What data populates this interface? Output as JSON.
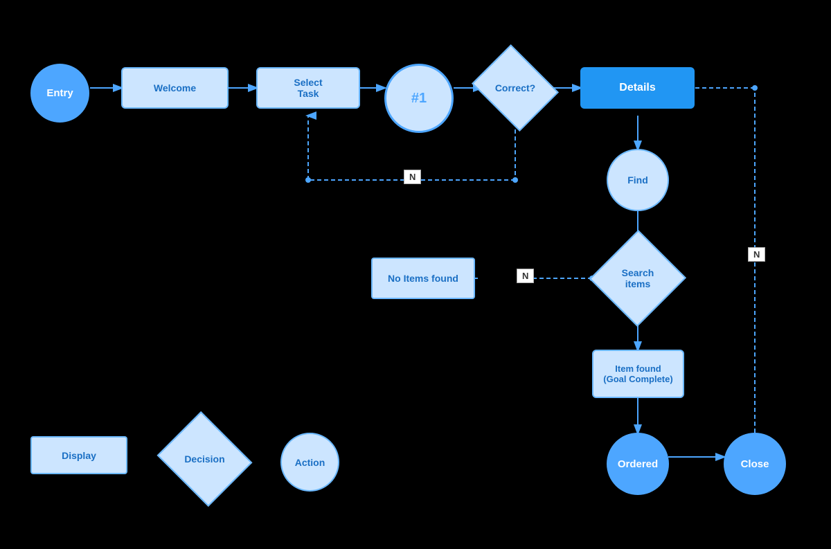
{
  "nodes": {
    "entry": {
      "label": "Entry"
    },
    "welcome": {
      "label": "Welcome"
    },
    "selectTask": {
      "label": "Select\nTask"
    },
    "num1": {
      "label": "#1"
    },
    "correct": {
      "label": "Correct?"
    },
    "details": {
      "label": "Details"
    },
    "find": {
      "label": "Find"
    },
    "searchItems": {
      "label": "Search\nitems"
    },
    "noItemsFound": {
      "label": "No Items found"
    },
    "itemFound": {
      "label": "Item found\n(Goal Complete)"
    },
    "ordered": {
      "label": "Ordered"
    },
    "close": {
      "label": "Close"
    },
    "legendDisplay": {
      "label": "Display"
    },
    "legendDecision": {
      "label": "Decision"
    },
    "legendAction": {
      "label": "Action"
    }
  },
  "nLabels": {
    "n1": "N",
    "n2": "N"
  },
  "colors": {
    "filledCircle": "#4da6ff",
    "outlineCircle": "#cce5ff",
    "outlineBorder": "#6bb8ff",
    "rectDisplay": "#cce5ff",
    "rectFilled": "#2196f3",
    "arrowColor": "#4da6ff",
    "dashColor": "#4da6ff",
    "textDark": "#1a6fc4",
    "textWhite": "#fff"
  }
}
